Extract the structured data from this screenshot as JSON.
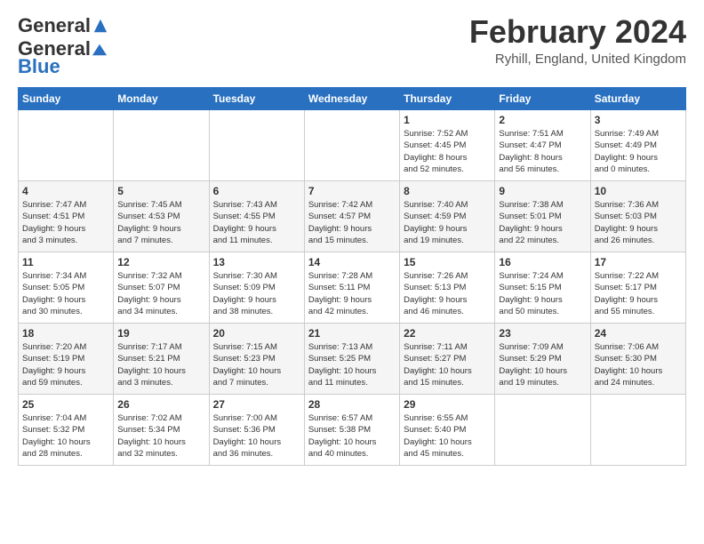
{
  "logo": {
    "general": "General",
    "blue": "Blue"
  },
  "title": "February 2024",
  "subtitle": "Ryhill, England, United Kingdom",
  "days_of_week": [
    "Sunday",
    "Monday",
    "Tuesday",
    "Wednesday",
    "Thursday",
    "Friday",
    "Saturday"
  ],
  "weeks": [
    [
      {
        "day": "",
        "info": ""
      },
      {
        "day": "",
        "info": ""
      },
      {
        "day": "",
        "info": ""
      },
      {
        "day": "",
        "info": ""
      },
      {
        "day": "1",
        "info": "Sunrise: 7:52 AM\nSunset: 4:45 PM\nDaylight: 8 hours\nand 52 minutes."
      },
      {
        "day": "2",
        "info": "Sunrise: 7:51 AM\nSunset: 4:47 PM\nDaylight: 8 hours\nand 56 minutes."
      },
      {
        "day": "3",
        "info": "Sunrise: 7:49 AM\nSunset: 4:49 PM\nDaylight: 9 hours\nand 0 minutes."
      }
    ],
    [
      {
        "day": "4",
        "info": "Sunrise: 7:47 AM\nSunset: 4:51 PM\nDaylight: 9 hours\nand 3 minutes."
      },
      {
        "day": "5",
        "info": "Sunrise: 7:45 AM\nSunset: 4:53 PM\nDaylight: 9 hours\nand 7 minutes."
      },
      {
        "day": "6",
        "info": "Sunrise: 7:43 AM\nSunset: 4:55 PM\nDaylight: 9 hours\nand 11 minutes."
      },
      {
        "day": "7",
        "info": "Sunrise: 7:42 AM\nSunset: 4:57 PM\nDaylight: 9 hours\nand 15 minutes."
      },
      {
        "day": "8",
        "info": "Sunrise: 7:40 AM\nSunset: 4:59 PM\nDaylight: 9 hours\nand 19 minutes."
      },
      {
        "day": "9",
        "info": "Sunrise: 7:38 AM\nSunset: 5:01 PM\nDaylight: 9 hours\nand 22 minutes."
      },
      {
        "day": "10",
        "info": "Sunrise: 7:36 AM\nSunset: 5:03 PM\nDaylight: 9 hours\nand 26 minutes."
      }
    ],
    [
      {
        "day": "11",
        "info": "Sunrise: 7:34 AM\nSunset: 5:05 PM\nDaylight: 9 hours\nand 30 minutes."
      },
      {
        "day": "12",
        "info": "Sunrise: 7:32 AM\nSunset: 5:07 PM\nDaylight: 9 hours\nand 34 minutes."
      },
      {
        "day": "13",
        "info": "Sunrise: 7:30 AM\nSunset: 5:09 PM\nDaylight: 9 hours\nand 38 minutes."
      },
      {
        "day": "14",
        "info": "Sunrise: 7:28 AM\nSunset: 5:11 PM\nDaylight: 9 hours\nand 42 minutes."
      },
      {
        "day": "15",
        "info": "Sunrise: 7:26 AM\nSunset: 5:13 PM\nDaylight: 9 hours\nand 46 minutes."
      },
      {
        "day": "16",
        "info": "Sunrise: 7:24 AM\nSunset: 5:15 PM\nDaylight: 9 hours\nand 50 minutes."
      },
      {
        "day": "17",
        "info": "Sunrise: 7:22 AM\nSunset: 5:17 PM\nDaylight: 9 hours\nand 55 minutes."
      }
    ],
    [
      {
        "day": "18",
        "info": "Sunrise: 7:20 AM\nSunset: 5:19 PM\nDaylight: 9 hours\nand 59 minutes."
      },
      {
        "day": "19",
        "info": "Sunrise: 7:17 AM\nSunset: 5:21 PM\nDaylight: 10 hours\nand 3 minutes."
      },
      {
        "day": "20",
        "info": "Sunrise: 7:15 AM\nSunset: 5:23 PM\nDaylight: 10 hours\nand 7 minutes."
      },
      {
        "day": "21",
        "info": "Sunrise: 7:13 AM\nSunset: 5:25 PM\nDaylight: 10 hours\nand 11 minutes."
      },
      {
        "day": "22",
        "info": "Sunrise: 7:11 AM\nSunset: 5:27 PM\nDaylight: 10 hours\nand 15 minutes."
      },
      {
        "day": "23",
        "info": "Sunrise: 7:09 AM\nSunset: 5:29 PM\nDaylight: 10 hours\nand 19 minutes."
      },
      {
        "day": "24",
        "info": "Sunrise: 7:06 AM\nSunset: 5:30 PM\nDaylight: 10 hours\nand 24 minutes."
      }
    ],
    [
      {
        "day": "25",
        "info": "Sunrise: 7:04 AM\nSunset: 5:32 PM\nDaylight: 10 hours\nand 28 minutes."
      },
      {
        "day": "26",
        "info": "Sunrise: 7:02 AM\nSunset: 5:34 PM\nDaylight: 10 hours\nand 32 minutes."
      },
      {
        "day": "27",
        "info": "Sunrise: 7:00 AM\nSunset: 5:36 PM\nDaylight: 10 hours\nand 36 minutes."
      },
      {
        "day": "28",
        "info": "Sunrise: 6:57 AM\nSunset: 5:38 PM\nDaylight: 10 hours\nand 40 minutes."
      },
      {
        "day": "29",
        "info": "Sunrise: 6:55 AM\nSunset: 5:40 PM\nDaylight: 10 hours\nand 45 minutes."
      },
      {
        "day": "",
        "info": ""
      },
      {
        "day": "",
        "info": ""
      }
    ]
  ]
}
